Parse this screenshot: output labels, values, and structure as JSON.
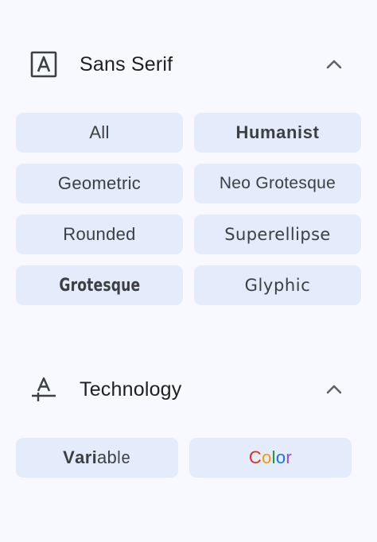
{
  "sections": {
    "sans_serif": {
      "title": "Sans Serif",
      "icon": "letter-a-box-icon",
      "collapse_icon": "chevron-up-icon",
      "chips": [
        {
          "label": "All"
        },
        {
          "label": "Humanist"
        },
        {
          "label": "Geometric"
        },
        {
          "label": "Neo Grotesque"
        },
        {
          "label": "Rounded"
        },
        {
          "label": "Superellipse"
        },
        {
          "label": "Grotesque"
        },
        {
          "label": "Glyphic"
        }
      ]
    },
    "technology": {
      "title": "Technology",
      "icon": "letter-a-baseline-icon",
      "collapse_icon": "chevron-up-icon",
      "chips": [
        {
          "label": "Variable",
          "parts": [
            "V",
            "a",
            "r",
            "i",
            "a",
            "b",
            "l",
            "e"
          ]
        },
        {
          "label": "Color",
          "parts": [
            "C",
            "o",
            "l",
            "o",
            "r"
          ]
        }
      ]
    }
  },
  "colors": {
    "background": "#f7f9fe",
    "chip": "#e4ecfb",
    "color_letters": [
      "#d93025",
      "#f29900",
      "#1e8e3e",
      "#1a73e8",
      "#a142f4"
    ]
  }
}
